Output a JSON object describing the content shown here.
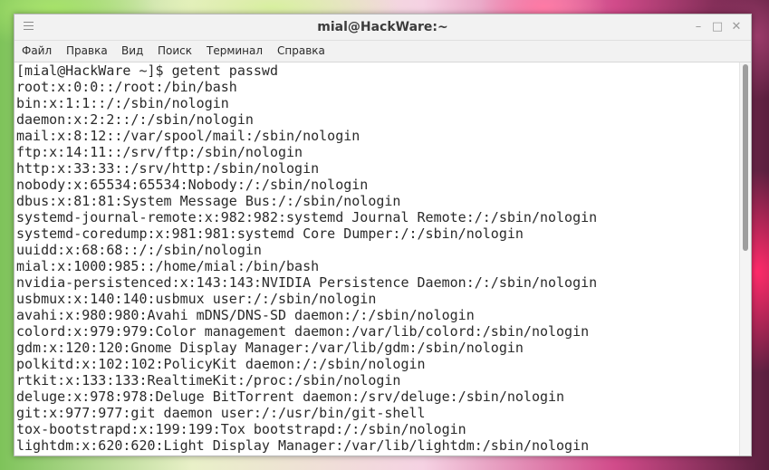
{
  "window": {
    "title": "mial@HackWare:~",
    "minimize_glyph": "–",
    "maximize_glyph": "□",
    "close_glyph": "✕"
  },
  "menu": {
    "items": [
      "Файл",
      "Правка",
      "Вид",
      "Поиск",
      "Терминал",
      "Справка"
    ]
  },
  "terminal": {
    "lines": [
      "[mial@HackWare ~]$ getent passwd",
      "root:x:0:0::/root:/bin/bash",
      "bin:x:1:1::/:/sbin/nologin",
      "daemon:x:2:2::/:/sbin/nologin",
      "mail:x:8:12::/var/spool/mail:/sbin/nologin",
      "ftp:x:14:11::/srv/ftp:/sbin/nologin",
      "http:x:33:33::/srv/http:/sbin/nologin",
      "nobody:x:65534:65534:Nobody:/:/sbin/nologin",
      "dbus:x:81:81:System Message Bus:/:/sbin/nologin",
      "systemd-journal-remote:x:982:982:systemd Journal Remote:/:/sbin/nologin",
      "systemd-coredump:x:981:981:systemd Core Dumper:/:/sbin/nologin",
      "uuidd:x:68:68::/:/sbin/nologin",
      "mial:x:1000:985::/home/mial:/bin/bash",
      "nvidia-persistenced:x:143:143:NVIDIA Persistence Daemon:/:/sbin/nologin",
      "usbmux:x:140:140:usbmux user:/:/sbin/nologin",
      "avahi:x:980:980:Avahi mDNS/DNS-SD daemon:/:/sbin/nologin",
      "colord:x:979:979:Color management daemon:/var/lib/colord:/sbin/nologin",
      "gdm:x:120:120:Gnome Display Manager:/var/lib/gdm:/sbin/nologin",
      "polkitd:x:102:102:PolicyKit daemon:/:/sbin/nologin",
      "rtkit:x:133:133:RealtimeKit:/proc:/sbin/nologin",
      "deluge:x:978:978:Deluge BitTorrent daemon:/srv/deluge:/sbin/nologin",
      "git:x:977:977:git daemon user:/:/usr/bin/git-shell",
      "tox-bootstrapd:x:199:199:Tox bootstrapd:/:/sbin/nologin",
      "lightdm:x:620:620:Light Display Manager:/var/lib/lightdm:/sbin/nologin"
    ]
  },
  "scrollbar": {
    "position_fraction": 0.0,
    "visible_fraction": 0.48
  },
  "colors": {
    "terminal_background": "#ffffff",
    "terminal_text": "#2a2a2a",
    "titlebar_background": "#f2f2f2"
  }
}
